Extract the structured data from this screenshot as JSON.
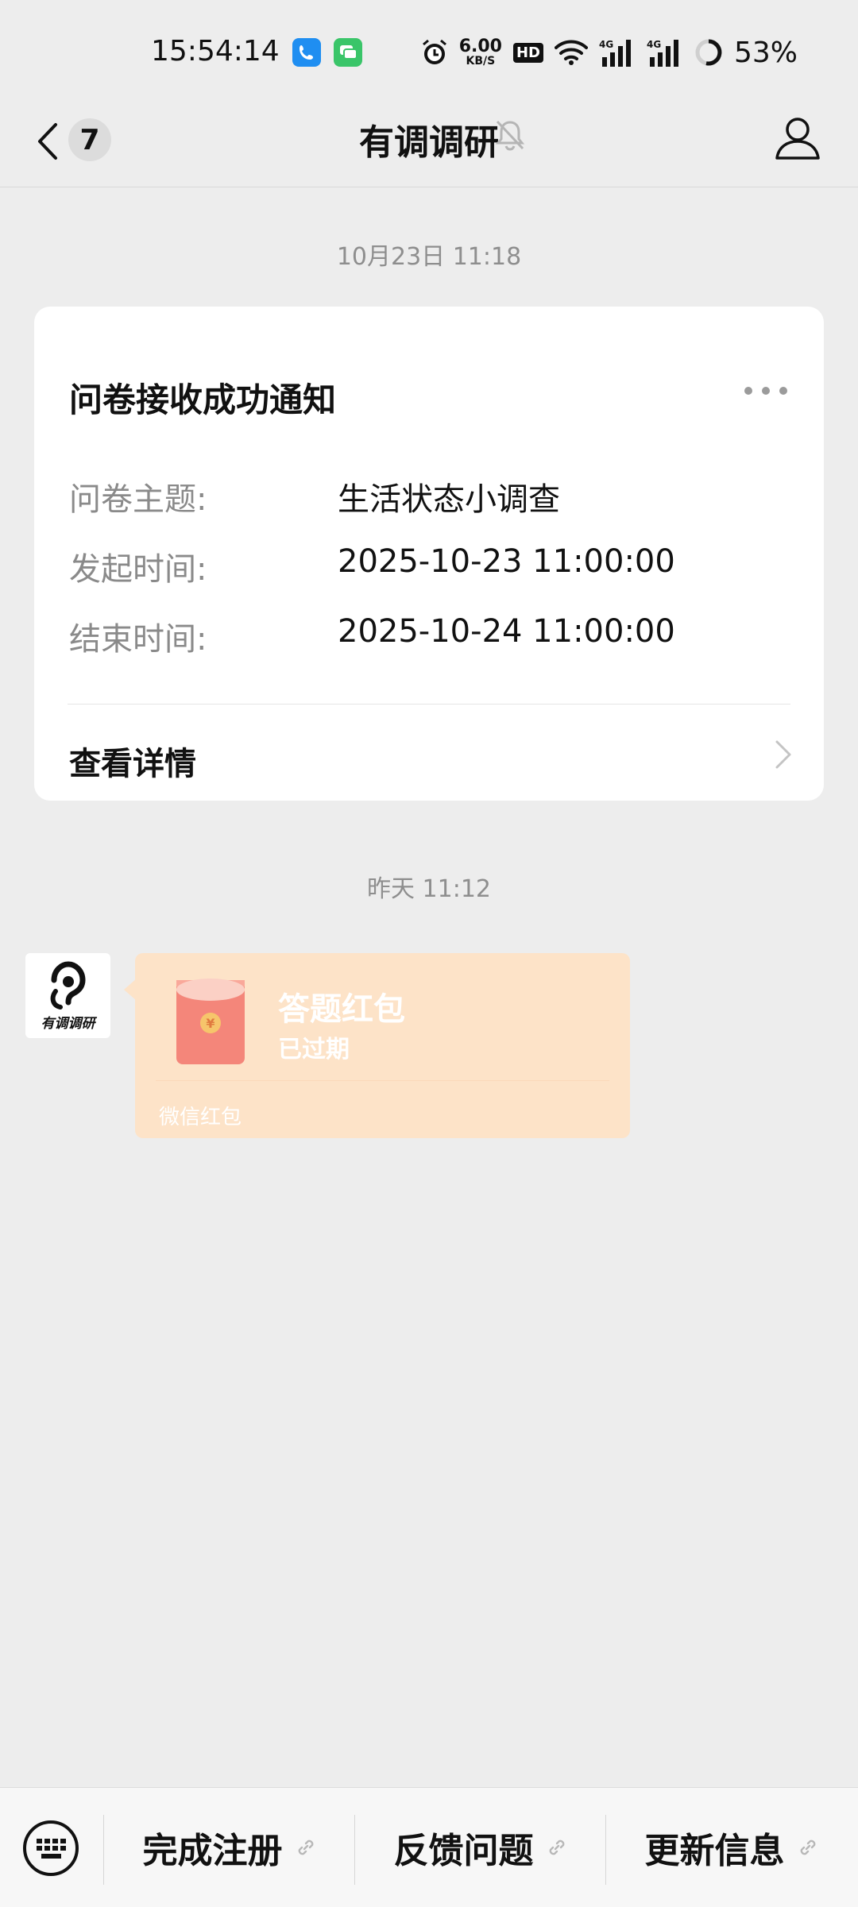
{
  "status_bar": {
    "time": "15:54:14",
    "net_speed_value": "6.00",
    "net_speed_unit": "KB/S",
    "hd_badge": "HD",
    "battery": "53%"
  },
  "nav": {
    "title": "有调调研",
    "unread_count": "7"
  },
  "messages": {
    "timestamp_1": "10月23日 11:18",
    "timestamp_2": "昨天 11:12"
  },
  "card": {
    "title": "问卷接收成功通知",
    "rows": [
      {
        "label": "问卷主题:",
        "value": "生活状态小调查"
      },
      {
        "label": "发起时间:",
        "value": "2025-10-23 11:00:00"
      },
      {
        "label": "结束时间:",
        "value": "2025-10-24 11:00:00"
      }
    ],
    "action_label": "查看详情"
  },
  "sender": {
    "avatar_text": "有调调研"
  },
  "red_packet": {
    "title": "答题红包",
    "status": "已过期",
    "footer": "微信红包",
    "symbol": "¥"
  },
  "bottom_menu": {
    "items": [
      {
        "label": "完成注册"
      },
      {
        "label": "反馈问题"
      },
      {
        "label": "更新信息"
      }
    ]
  },
  "colors": {
    "background": "#ededed",
    "card": "#ffffff",
    "red_packet_bg": "#fde3c8",
    "red_packet_icon": "#f4867a"
  },
  "icons": [
    "phone-app-icon",
    "messages-app-icon",
    "alarm-icon",
    "wifi-icon",
    "signal-4g-icon",
    "battery-icon",
    "back-chevron-icon",
    "mute-bell-icon",
    "profile-icon",
    "more-icon",
    "chevron-right-icon",
    "red-packet-icon",
    "keyboard-icon",
    "link-icon"
  ]
}
